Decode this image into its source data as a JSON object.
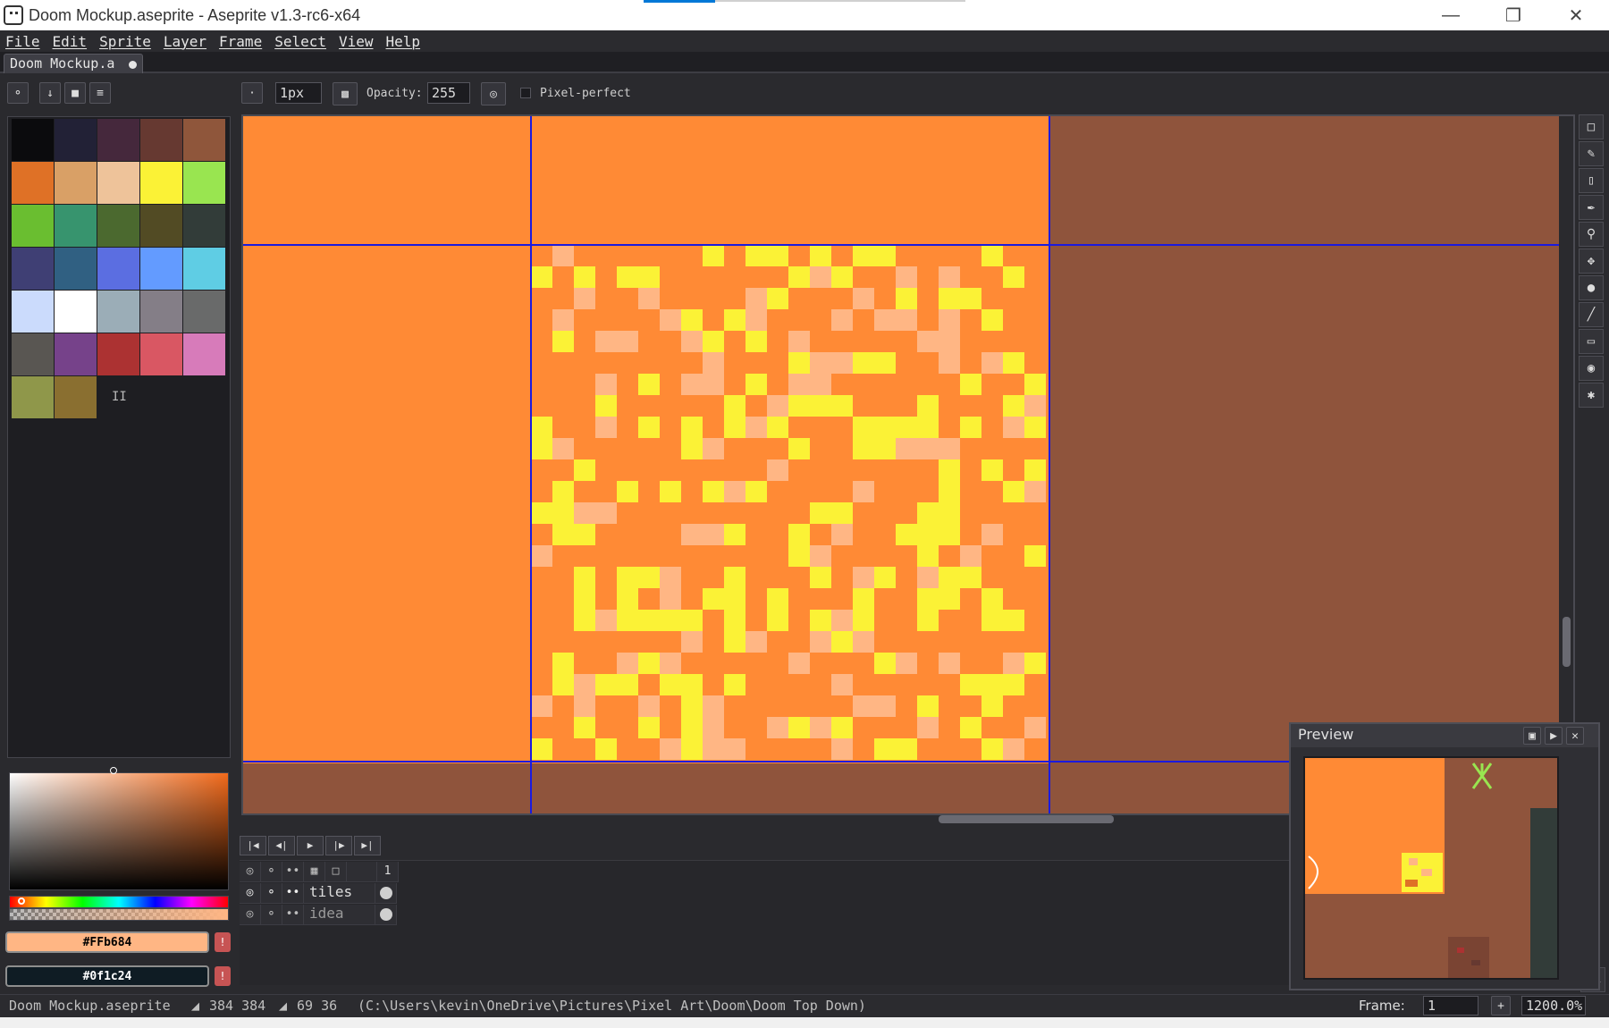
{
  "window": {
    "title": "Doom Mockup.aseprite - Aseprite v1.3-rc6-x64",
    "controls": [
      "minimize-icon",
      "restore-icon",
      "close-icon"
    ]
  },
  "menu": [
    "File",
    "Edit",
    "Sprite",
    "Layer",
    "Frame",
    "Select",
    "View",
    "Help"
  ],
  "tab": {
    "label": "Doom Mockup.a"
  },
  "toolbar": {
    "brush_size": "1px",
    "opacity_label": "Opacity:",
    "opacity": "255",
    "pixel_perfect_label": "Pixel-perfect"
  },
  "palette": {
    "colors": [
      "#0b0b0d",
      "#222136",
      "#45283c",
      "#663931",
      "#8f563b",
      "#df7126",
      "#d9a066",
      "#eec39a",
      "#fbf236",
      "#99e550",
      "#6abe30",
      "#37946e",
      "#4b692f",
      "#524b24",
      "#323c39",
      "#3f3f74",
      "#306082",
      "#5b6ee1",
      "#639bff",
      "#5fcde4",
      "#cbdbfc",
      "#ffffff",
      "#9badb7",
      "#847e87",
      "#696a6a",
      "#595652",
      "#76428a",
      "#ac3232",
      "#d95763",
      "#d77bba",
      "#8f974a",
      "#8a6f30"
    ],
    "handle": "II"
  },
  "colors": {
    "foreground_hex": "#ffb684",
    "foreground_label": "#FFb684",
    "background_hex": "#0f1c24",
    "background_label": "#0f1c24"
  },
  "canvas": {
    "orange": "#ff8a35",
    "brown": "#8f543c",
    "light": "#ffb684",
    "yellow": "#fbf236",
    "grid_color": "#1a1adf"
  },
  "timeline": {
    "frame_header": "1",
    "layers": [
      {
        "name": "tiles"
      },
      {
        "name": "idea"
      }
    ]
  },
  "preview": {
    "title": "Preview"
  },
  "status": {
    "file": "Doom Mockup.aseprite",
    "size": "384 384",
    "selection": "69 36",
    "path": "(C:\\Users\\kevin\\OneDrive\\Pictures\\Pixel Art\\Doom\\Doom Top Down)",
    "frame_label": "Frame:",
    "frame_value": "1",
    "zoom": "1200.0%"
  }
}
